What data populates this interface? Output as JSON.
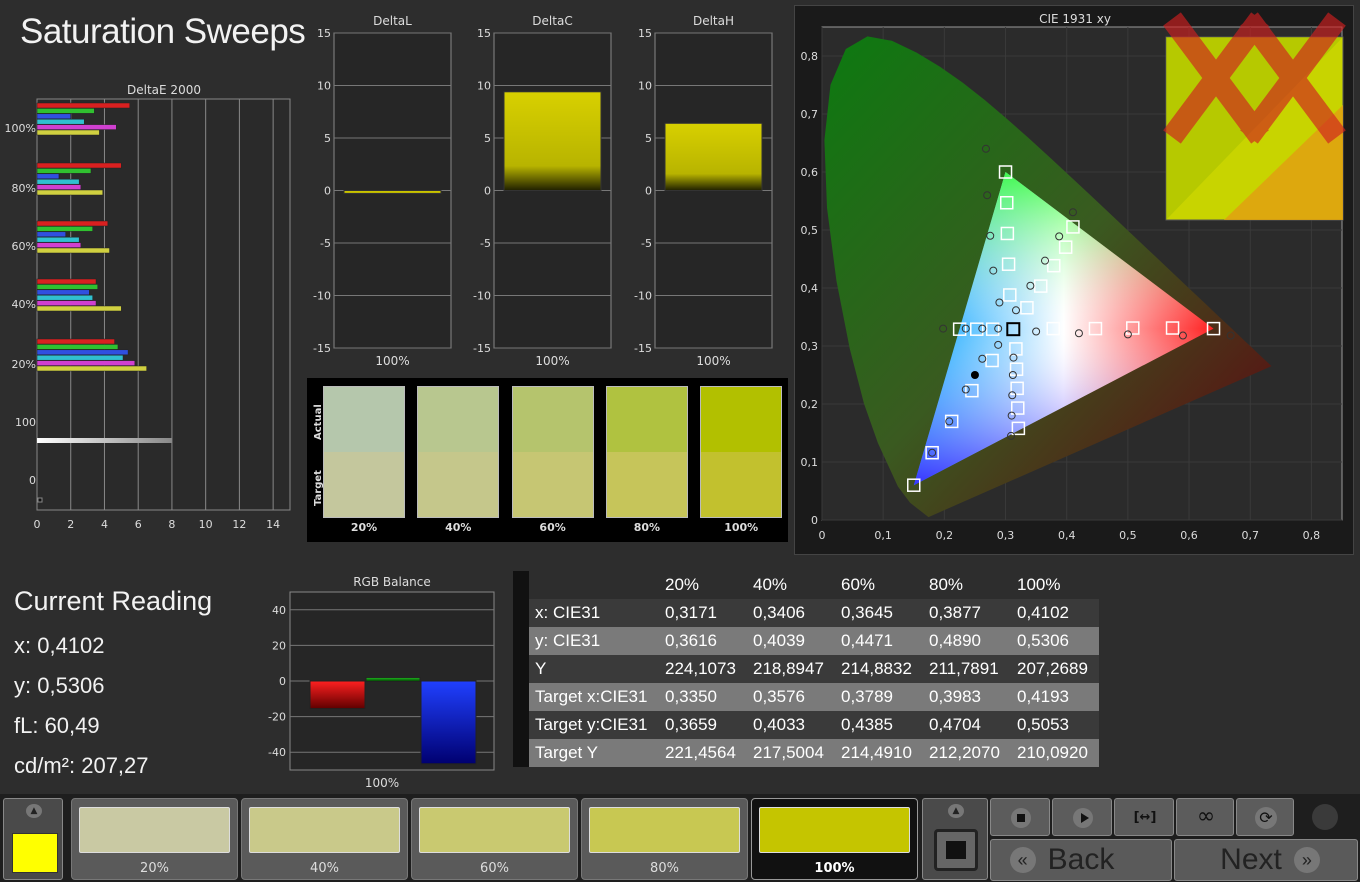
{
  "title": "Saturation Sweeps",
  "deltae": {
    "title": "DeltaE 2000",
    "ylabels": [
      "100%",
      "80%",
      "60%",
      "40%",
      "20%",
      "100",
      "0"
    ],
    "xticks": [
      "0",
      "2",
      "4",
      "6",
      "8",
      "10",
      "12",
      "14"
    ],
    "groups": [
      {
        "label": "100%",
        "values": [
          5.5,
          3.4,
          2.0,
          2.8,
          4.7,
          3.7
        ]
      },
      {
        "label": "80%",
        "values": [
          5.0,
          3.2,
          1.3,
          2.5,
          2.6,
          3.9
        ]
      },
      {
        "label": "60%",
        "values": [
          4.2,
          3.3,
          1.7,
          2.5,
          2.6,
          4.3
        ]
      },
      {
        "label": "40%",
        "values": [
          3.5,
          3.6,
          3.1,
          3.3,
          3.5,
          5.0
        ]
      },
      {
        "label": "20%",
        "values": [
          4.6,
          4.8,
          5.4,
          5.1,
          5.8,
          6.5
        ]
      }
    ],
    "gray_value": 8.0,
    "colors": [
      "#d92020",
      "#30c030",
      "#3050e0",
      "#30c0d0",
      "#d040d0",
      "#d0d040"
    ]
  },
  "delta_panels": [
    {
      "title": "DeltaL",
      "value": -0.2,
      "xlabel": "100%"
    },
    {
      "title": "DeltaC",
      "value": 9.4,
      "xlabel": "100%"
    },
    {
      "title": "DeltaH",
      "value": 6.4,
      "xlabel": "100%"
    }
  ],
  "delta_yticks": [
    "15",
    "10",
    "5",
    "0",
    "-5",
    "-10",
    "-15"
  ],
  "compare": {
    "actual_label": "Actual",
    "target_label": "Target",
    "items": [
      {
        "label": "20%",
        "actual": "#b5c7ac",
        "target": "#c4c79d"
      },
      {
        "label": "40%",
        "actual": "#b8c78f",
        "target": "#c5c78b"
      },
      {
        "label": "60%",
        "actual": "#b5c46d",
        "target": "#c6c673"
      },
      {
        "label": "80%",
        "actual": "#b0c240",
        "target": "#c6c55a"
      },
      {
        "label": "100%",
        "actual": "#b2c000",
        "target": "#c2c12e"
      }
    ]
  },
  "cie": {
    "title": "CIE 1931 xy",
    "xticks": [
      "0",
      "0,1",
      "0,2",
      "0,3",
      "0,4",
      "0,5",
      "0,6",
      "0,7",
      "0,8"
    ],
    "yticks": [
      "0",
      "0,1",
      "0,2",
      "0,3",
      "0,4",
      "0,5",
      "0,6",
      "0,7",
      "0,8"
    ],
    "targets": [
      [
        0.64,
        0.33
      ],
      [
        0.573,
        0.331
      ],
      [
        0.508,
        0.331
      ],
      [
        0.447,
        0.33
      ],
      [
        0.378,
        0.33
      ],
      [
        0.3,
        0.6
      ],
      [
        0.302,
        0.547
      ],
      [
        0.303,
        0.494
      ],
      [
        0.305,
        0.441
      ],
      [
        0.307,
        0.388
      ],
      [
        0.15,
        0.06
      ],
      [
        0.18,
        0.116
      ],
      [
        0.212,
        0.17
      ],
      [
        0.245,
        0.223
      ],
      [
        0.278,
        0.275
      ],
      [
        0.225,
        0.329
      ],
      [
        0.253,
        0.329
      ],
      [
        0.279,
        0.329
      ],
      [
        0.4102,
        0.5053
      ],
      [
        0.3983,
        0.4704
      ],
      [
        0.3789,
        0.4385
      ],
      [
        0.3576,
        0.4033
      ],
      [
        0.335,
        0.3659
      ],
      [
        0.321,
        0.158
      ],
      [
        0.32,
        0.193
      ],
      [
        0.319,
        0.227
      ],
      [
        0.318,
        0.26
      ],
      [
        0.317,
        0.295
      ],
      [
        0.3127,
        0.329
      ]
    ],
    "measured": [
      [
        0.668,
        0.318
      ],
      [
        0.59,
        0.318
      ],
      [
        0.5,
        0.32
      ],
      [
        0.42,
        0.322
      ],
      [
        0.35,
        0.325
      ],
      [
        0.268,
        0.64
      ],
      [
        0.27,
        0.56
      ],
      [
        0.275,
        0.49
      ],
      [
        0.28,
        0.43
      ],
      [
        0.29,
        0.375
      ],
      [
        0.18,
        0.116
      ],
      [
        0.208,
        0.17
      ],
      [
        0.235,
        0.225
      ],
      [
        0.262,
        0.278
      ],
      [
        0.288,
        0.302
      ],
      [
        0.198,
        0.33
      ],
      [
        0.235,
        0.33
      ],
      [
        0.262,
        0.33
      ],
      [
        0.288,
        0.33
      ],
      [
        0.3171,
        0.3616
      ],
      [
        0.3406,
        0.4039
      ],
      [
        0.3645,
        0.4471
      ],
      [
        0.3877,
        0.489
      ],
      [
        0.4102,
        0.5306
      ],
      [
        0.309,
        0.145
      ],
      [
        0.31,
        0.18
      ],
      [
        0.311,
        0.215
      ],
      [
        0.312,
        0.25
      ],
      [
        0.313,
        0.28
      ]
    ],
    "white_point": [
      0.3127,
      0.329
    ],
    "current": [
      0.25,
      0.25
    ]
  },
  "current_reading": {
    "title": "Current Reading",
    "x": "x: 0,4102",
    "y": "y: 0,5306",
    "fl": "fL: 60,49",
    "cd": "cd/m²: 207,27"
  },
  "rgb_balance": {
    "title": "RGB Balance",
    "yticks": [
      "40",
      "20",
      "0",
      "-20",
      "-40"
    ],
    "values": {
      "r": -15.5,
      "g": 2.0,
      "b": -46.5
    },
    "xlabel": "100%"
  },
  "table": {
    "headers": [
      "",
      "20%",
      "40%",
      "60%",
      "80%",
      "100%"
    ],
    "rows": [
      [
        "x: CIE31",
        "0,3171",
        "0,3406",
        "0,3645",
        "0,3877",
        "0,4102"
      ],
      [
        "y: CIE31",
        "0,3616",
        "0,4039",
        "0,4471",
        "0,4890",
        "0,5306"
      ],
      [
        "Y",
        "224,1073",
        "218,8947",
        "214,8832",
        "211,7891",
        "207,2689"
      ],
      [
        "Target x:CIE31",
        "0,3350",
        "0,3576",
        "0,3789",
        "0,3983",
        "0,4193"
      ],
      [
        "Target y:CIE31",
        "0,3659",
        "0,4033",
        "0,4385",
        "0,4704",
        "0,5053"
      ],
      [
        "Target Y",
        "221,4564",
        "217,5004",
        "214,4910",
        "212,2070",
        "210,0920"
      ]
    ]
  },
  "bottom": {
    "current_color": "#ffff00",
    "swatches": [
      {
        "label": "20%",
        "color": "#c9c9a3"
      },
      {
        "label": "40%",
        "color": "#c9c98a"
      },
      {
        "label": "60%",
        "color": "#c9c970"
      },
      {
        "label": "80%",
        "color": "#c8c852"
      },
      {
        "label": "100%",
        "color": "#c5c500"
      }
    ],
    "back_label": "Back",
    "next_label": "Next"
  }
}
